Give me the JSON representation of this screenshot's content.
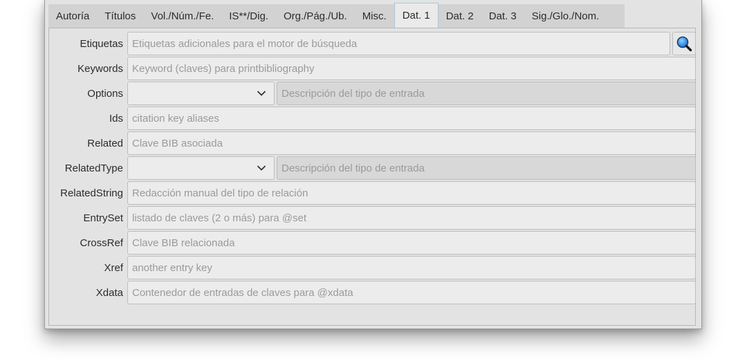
{
  "tabs": [
    {
      "label": "Autoría"
    },
    {
      "label": "Títulos"
    },
    {
      "label": "Vol./Núm./Fe."
    },
    {
      "label": "IS**/Dig."
    },
    {
      "label": "Org./Pág./Ub."
    },
    {
      "label": "Misc."
    },
    {
      "label": "Dat. 1",
      "active": true
    },
    {
      "label": "Dat. 2"
    },
    {
      "label": "Dat. 3"
    },
    {
      "label": "Sig./Glo./Nom."
    }
  ],
  "fields": {
    "etiquetas": {
      "label": "Etiquetas",
      "placeholder": "Etiquetas adicionales para el motor de búsqueda"
    },
    "keywords": {
      "label": "Keywords",
      "placeholder": "Keyword (claves) para printbibliography"
    },
    "options": {
      "label": "Options",
      "selected": "",
      "placeholder": "Descripción del tipo de entrada"
    },
    "ids": {
      "label": "Ids",
      "placeholder": "citation key aliases"
    },
    "related": {
      "label": "Related",
      "placeholder": "Clave BIB asociada"
    },
    "relatedtype": {
      "label": "RelatedType",
      "selected": "",
      "placeholder": "Descripción del tipo de entrada"
    },
    "relatedstring": {
      "label": "RelatedString",
      "placeholder": "Redacción manual del tipo de relación"
    },
    "entryset": {
      "label": "EntrySet",
      "placeholder": "listado de claves (2 o más) para @set"
    },
    "crossref": {
      "label": "CrossRef",
      "placeholder": "Clave BIB relacionada"
    },
    "xref": {
      "label": "Xref",
      "placeholder": "another entry key"
    },
    "xdata": {
      "label": "Xdata",
      "placeholder": "Contenedor de entradas de claves para @xdata"
    }
  },
  "icons": {
    "search_button": "magnifier-icon"
  },
  "colors": {
    "window_bg": "#e3e3e3",
    "tab_active_border": "#a9c6dc",
    "icon_blue": "#1e6fd0"
  }
}
